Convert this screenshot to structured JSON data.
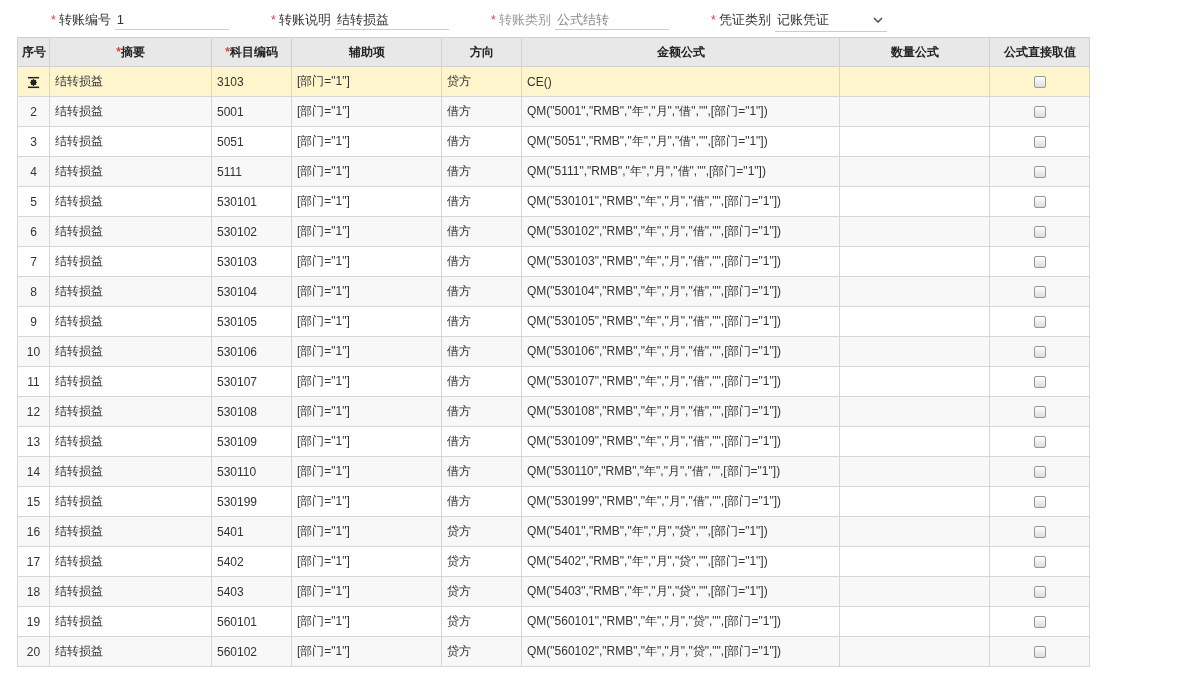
{
  "form": [
    {
      "mark": "*",
      "label": "转账编号",
      "value": "1",
      "kind": "text",
      "disabled": false
    },
    {
      "mark": "*",
      "label": "转账说明",
      "value": "结转损益",
      "kind": "text",
      "disabled": false
    },
    {
      "mark": "*",
      "label": "转账类别",
      "value": "公式结转",
      "kind": "text",
      "disabled": true
    },
    {
      "mark": "*",
      "label": "凭证类别",
      "value": "记账凭证",
      "kind": "select",
      "disabled": false
    }
  ],
  "table": {
    "columns": [
      {
        "label": "序号"
      },
      {
        "mark": "*",
        "label": "摘要"
      },
      {
        "mark": "*",
        "label": "科目编码"
      },
      {
        "label": "辅助项"
      },
      {
        "label": "方向"
      },
      {
        "label": "金额公式"
      },
      {
        "label": "数量公式"
      },
      {
        "label": "公式直接取值"
      }
    ],
    "rows": [
      {
        "selected": true,
        "summary": "结转损益",
        "code": "3103",
        "aux": "[部门=\"1\"]",
        "dir": "贷方",
        "formula": "CE()",
        "checked": false
      },
      {
        "selected": false,
        "seq": "2",
        "summary": "结转损益",
        "code": "5001",
        "aux": "[部门=\"1\"]",
        "dir": "借方",
        "formula": "QM(\"5001\",\"RMB\",\"年\",\"月\",\"借\",\"\",[部门=\"1\"])",
        "checked": false
      },
      {
        "selected": false,
        "seq": "3",
        "summary": "结转损益",
        "code": "5051",
        "aux": "[部门=\"1\"]",
        "dir": "借方",
        "formula": "QM(\"5051\",\"RMB\",\"年\",\"月\",\"借\",\"\",[部门=\"1\"])",
        "checked": false
      },
      {
        "selected": false,
        "seq": "4",
        "summary": "结转损益",
        "code": "5111",
        "aux": "[部门=\"1\"]",
        "dir": "借方",
        "formula": "QM(\"5111\",\"RMB\",\"年\",\"月\",\"借\",\"\",[部门=\"1\"])",
        "checked": false
      },
      {
        "selected": false,
        "seq": "5",
        "summary": "结转损益",
        "code": "530101",
        "aux": "[部门=\"1\"]",
        "dir": "借方",
        "formula": "QM(\"530101\",\"RMB\",\"年\",\"月\",\"借\",\"\",[部门=\"1\"])",
        "checked": false
      },
      {
        "selected": false,
        "seq": "6",
        "summary": "结转损益",
        "code": "530102",
        "aux": "[部门=\"1\"]",
        "dir": "借方",
        "formula": "QM(\"530102\",\"RMB\",\"年\",\"月\",\"借\",\"\",[部门=\"1\"])",
        "checked": false
      },
      {
        "selected": false,
        "seq": "7",
        "summary": "结转损益",
        "code": "530103",
        "aux": "[部门=\"1\"]",
        "dir": "借方",
        "formula": "QM(\"530103\",\"RMB\",\"年\",\"月\",\"借\",\"\",[部门=\"1\"])",
        "checked": false
      },
      {
        "selected": false,
        "seq": "8",
        "summary": "结转损益",
        "code": "530104",
        "aux": "[部门=\"1\"]",
        "dir": "借方",
        "formula": "QM(\"530104\",\"RMB\",\"年\",\"月\",\"借\",\"\",[部门=\"1\"])",
        "checked": false
      },
      {
        "selected": false,
        "seq": "9",
        "summary": "结转损益",
        "code": "530105",
        "aux": "[部门=\"1\"]",
        "dir": "借方",
        "formula": "QM(\"530105\",\"RMB\",\"年\",\"月\",\"借\",\"\",[部门=\"1\"])",
        "checked": false
      },
      {
        "selected": false,
        "seq": "10",
        "summary": "结转损益",
        "code": "530106",
        "aux": "[部门=\"1\"]",
        "dir": "借方",
        "formula": "QM(\"530106\",\"RMB\",\"年\",\"月\",\"借\",\"\",[部门=\"1\"])",
        "checked": false
      },
      {
        "selected": false,
        "seq": "11",
        "summary": "结转损益",
        "code": "530107",
        "aux": "[部门=\"1\"]",
        "dir": "借方",
        "formula": "QM(\"530107\",\"RMB\",\"年\",\"月\",\"借\",\"\",[部门=\"1\"])",
        "checked": false
      },
      {
        "selected": false,
        "seq": "12",
        "summary": "结转损益",
        "code": "530108",
        "aux": "[部门=\"1\"]",
        "dir": "借方",
        "formula": "QM(\"530108\",\"RMB\",\"年\",\"月\",\"借\",\"\",[部门=\"1\"])",
        "checked": false
      },
      {
        "selected": false,
        "seq": "13",
        "summary": "结转损益",
        "code": "530109",
        "aux": "[部门=\"1\"]",
        "dir": "借方",
        "formula": "QM(\"530109\",\"RMB\",\"年\",\"月\",\"借\",\"\",[部门=\"1\"])",
        "checked": false
      },
      {
        "selected": false,
        "seq": "14",
        "summary": "结转损益",
        "code": "530110",
        "aux": "[部门=\"1\"]",
        "dir": "借方",
        "formula": "QM(\"530110\",\"RMB\",\"年\",\"月\",\"借\",\"\",[部门=\"1\"])",
        "checked": false
      },
      {
        "selected": false,
        "seq": "15",
        "summary": "结转损益",
        "code": "530199",
        "aux": "[部门=\"1\"]",
        "dir": "借方",
        "formula": "QM(\"530199\",\"RMB\",\"年\",\"月\",\"借\",\"\",[部门=\"1\"])",
        "checked": false
      },
      {
        "selected": false,
        "seq": "16",
        "summary": "结转损益",
        "code": "5401",
        "aux": "[部门=\"1\"]",
        "dir": "贷方",
        "formula": "QM(\"5401\",\"RMB\",\"年\",\"月\",\"贷\",\"\",[部门=\"1\"])",
        "checked": false
      },
      {
        "selected": false,
        "seq": "17",
        "summary": "结转损益",
        "code": "5402",
        "aux": "[部门=\"1\"]",
        "dir": "贷方",
        "formula": "QM(\"5402\",\"RMB\",\"年\",\"月\",\"贷\",\"\",[部门=\"1\"])",
        "checked": false
      },
      {
        "selected": false,
        "seq": "18",
        "summary": "结转损益",
        "code": "5403",
        "aux": "[部门=\"1\"]",
        "dir": "贷方",
        "formula": "QM(\"5403\",\"RMB\",\"年\",\"月\",\"贷\",\"\",[部门=\"1\"])",
        "checked": false
      },
      {
        "selected": false,
        "seq": "19",
        "summary": "结转损益",
        "code": "560101",
        "aux": "[部门=\"1\"]",
        "dir": "贷方",
        "formula": "QM(\"560101\",\"RMB\",\"年\",\"月\",\"贷\",\"\",[部门=\"1\"])",
        "checked": false
      },
      {
        "selected": false,
        "seq": "20",
        "summary": "结转损益",
        "code": "560102",
        "aux": "[部门=\"1\"]",
        "dir": "贷方",
        "formula": "QM(\"560102\",\"RMB\",\"年\",\"月\",\"贷\",\"\",[部门=\"1\"])",
        "checked": false
      }
    ]
  }
}
